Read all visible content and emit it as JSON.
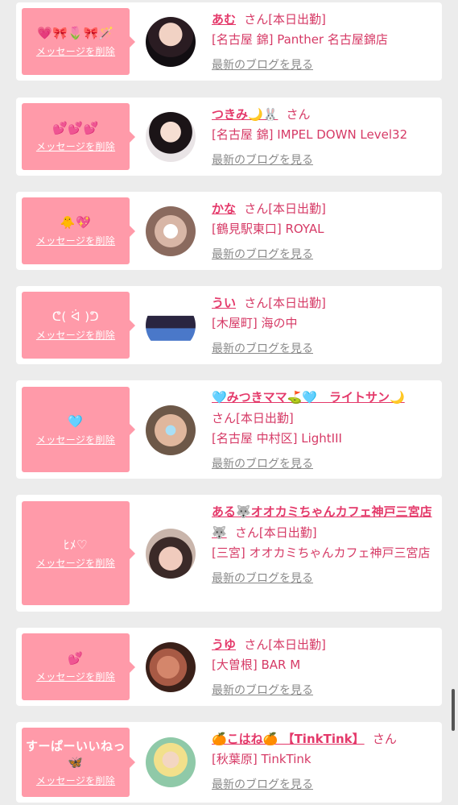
{
  "delete_label": "メッセージを削除",
  "blog_label": "最新のブログを見る",
  "san_label": "さん",
  "colors": {
    "bubble": "#ff9aa9",
    "name": "#e4396a",
    "text": "#d63a66",
    "link": "#8a8a8a"
  },
  "items": [
    {
      "message": "💗🎀🌷🎀🪄",
      "name": "あむ",
      "status": "[本日出勤]",
      "shop": "[名古屋 錦] Panther 名古屋錦店",
      "avatar": "avatar-photo"
    },
    {
      "message": "💕💕💕",
      "name": "つきみ🌙🐰",
      "status": "",
      "shop": "[名古屋 錦] IMPEL DOWN Level32",
      "avatar": "avatar-photo"
    },
    {
      "message": "🐥💖",
      "name": "かな",
      "status": "[本日出勤]",
      "shop": "[鶴見駅東口] ROYAL",
      "avatar": "avatar-photo"
    },
    {
      "message": "ᕦ( ᐛ )ᕤ",
      "name": "うい",
      "status": "[本日出勤]",
      "shop": "[木屋町] 海の中",
      "avatar": "avatar-photo"
    },
    {
      "message": "🩵",
      "name": "🩵みつきママ⛳🩵　ライトサン🌙",
      "status": "[本日出勤]",
      "shop": "[名古屋 中村区] LightIII",
      "avatar": "avatar-photo"
    },
    {
      "message": "ﾋﾒ♡",
      "name": "ある🐺オオカミちゃんカフェ神戸三宮店🐺",
      "status": "[本日出勤]",
      "shop": "[三宮] オオカミちゃんカフェ神戸三宮店",
      "avatar": "avatar-photo"
    },
    {
      "message": "💕",
      "name": "うゆ",
      "status": "[本日出勤]",
      "shop": "[大曽根] BAR M",
      "avatar": "avatar-photo"
    },
    {
      "message": "すーぱーいいねっ🦋",
      "name": "🍊こはね🍊 【TinkTink】",
      "status": "",
      "shop": "[秋葉原] TinkTink",
      "avatar": "avatar-photo"
    }
  ]
}
